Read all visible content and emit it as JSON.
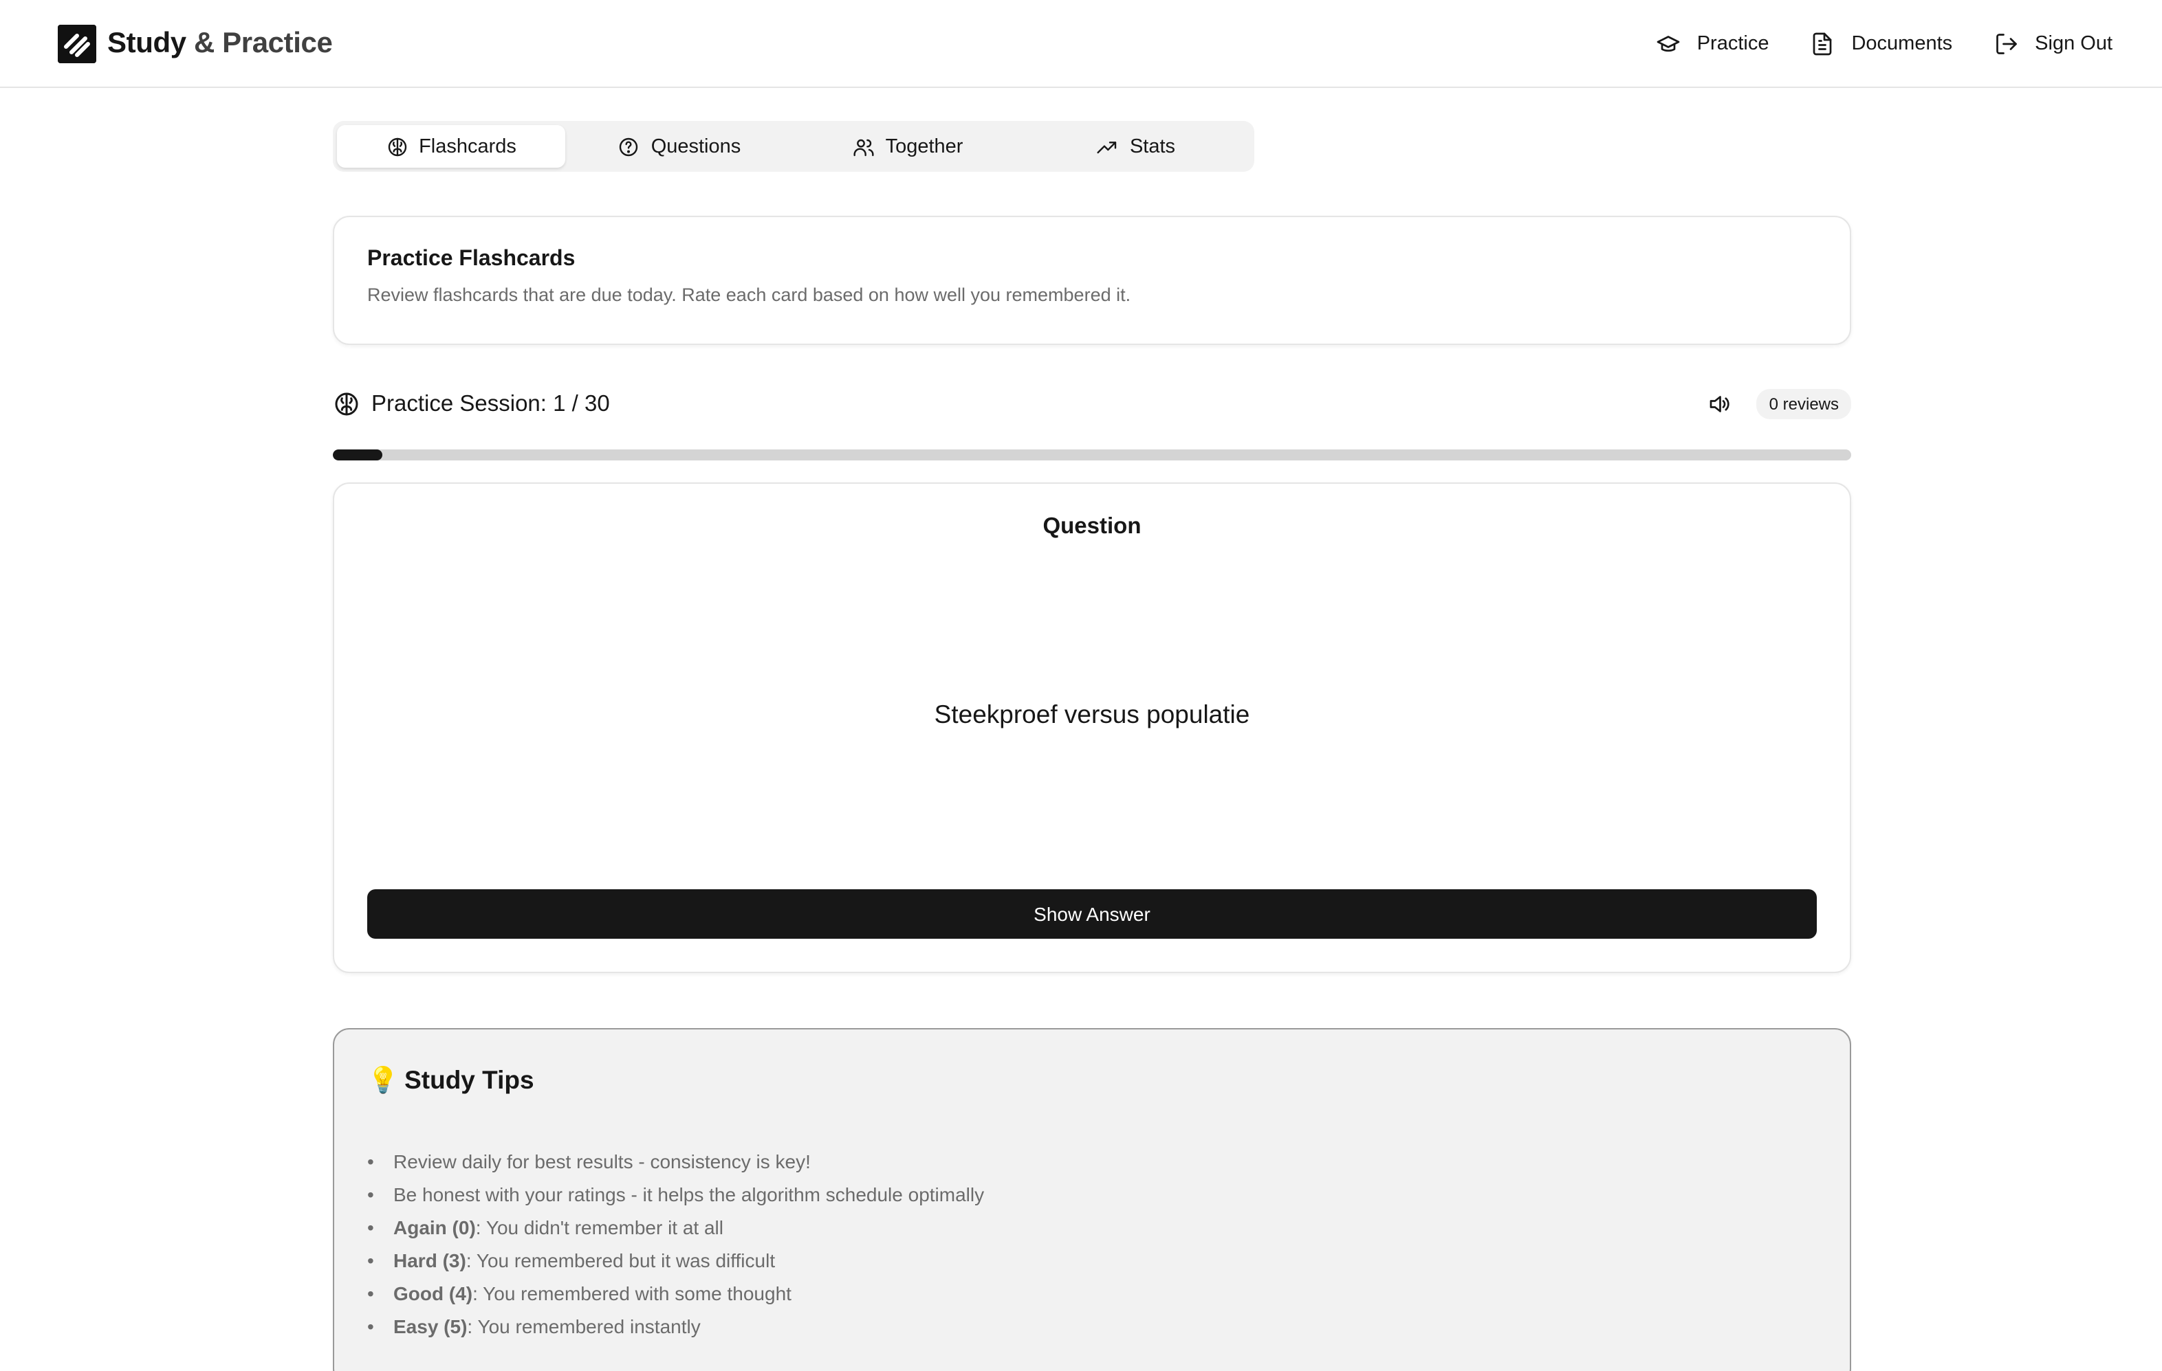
{
  "header": {
    "brand_main": "Study",
    "brand_sub": "& Practice",
    "nav": [
      {
        "label": "Practice",
        "icon": "graduation-cap-icon"
      },
      {
        "label": "Documents",
        "icon": "document-icon"
      },
      {
        "label": "Sign Out",
        "icon": "sign-out-icon"
      }
    ]
  },
  "tabs": [
    {
      "label": "Flashcards",
      "icon": "brain-icon",
      "active": true
    },
    {
      "label": "Questions",
      "icon": "help-circle-icon",
      "active": false
    },
    {
      "label": "Together",
      "icon": "users-icon",
      "active": false
    },
    {
      "label": "Stats",
      "icon": "trending-up-icon",
      "active": false
    }
  ],
  "intro": {
    "title": "Practice Flashcards",
    "description": "Review flashcards that are due today. Rate each card based on how well you remembered it."
  },
  "session": {
    "label": "Practice Session: 1 / 30",
    "reviews_badge": "0 reviews",
    "progress_fraction": 0.033
  },
  "card": {
    "label": "Question",
    "text": "Steekproef versus populatie",
    "show_answer_label": "Show Answer"
  },
  "tips": {
    "emoji": "💡",
    "title": "Study Tips",
    "items": [
      {
        "bold": "",
        "text": "Review daily for best results - consistency is key!"
      },
      {
        "bold": "",
        "text": "Be honest with your ratings - it helps the algorithm schedule optimally"
      },
      {
        "bold": "Again (0)",
        "text": ": You didn't remember it at all"
      },
      {
        "bold": "Hard (3)",
        "text": ": You remembered but it was difficult"
      },
      {
        "bold": "Good (4)",
        "text": ": You remembered with some thought"
      },
      {
        "bold": "Easy (5)",
        "text": ": You remembered instantly"
      }
    ]
  },
  "colors": {
    "primary": "#171717",
    "muted_text": "#6b6b6b",
    "tab_bg": "#f2f2f2",
    "progress_track": "#d4d4d4"
  }
}
